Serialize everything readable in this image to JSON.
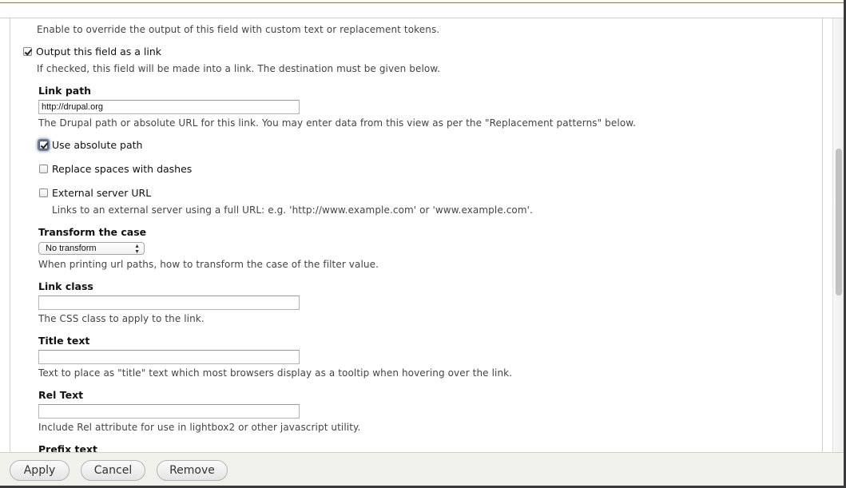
{
  "form": {
    "rewrite_description": "Enable to override the output of this field with custom text or replacement tokens.",
    "output_as_link": {
      "label": "Output this field as a link",
      "checked": true,
      "description": "If checked, this field will be made into a link. The destination must be given below."
    },
    "link_path": {
      "label": "Link path",
      "value": "http://drupal.org",
      "description": "The Drupal path or absolute URL for this link. You may enter data from this view as per the \"Replacement patterns\" below."
    },
    "use_absolute_path": {
      "label": "Use absolute path",
      "checked": true
    },
    "replace_spaces": {
      "label": "Replace spaces with dashes",
      "checked": false
    },
    "external_server": {
      "label": "External server URL",
      "checked": false,
      "description": "Links to an external server using a full URL: e.g. 'http://www.example.com' or 'www.example.com'."
    },
    "transform_case": {
      "label": "Transform the case",
      "selected": "No transform",
      "description": "When printing url paths, how to transform the case of the filter value."
    },
    "link_class": {
      "label": "Link class",
      "value": "",
      "description": "The CSS class to apply to the link."
    },
    "title_text": {
      "label": "Title text",
      "value": "",
      "description": "Text to place as \"title\" text which most browsers display as a tooltip when hovering over the link."
    },
    "rel_text": {
      "label": "Rel Text",
      "value": "",
      "description": "Include Rel attribute for use in lightbox2 or other javascript utility."
    },
    "prefix_text": {
      "label": "Prefix text"
    }
  },
  "footer": {
    "apply_label": "Apply",
    "cancel_label": "Cancel",
    "remove_label": "Remove"
  },
  "colors": {
    "accent_border": "#e0622f",
    "footer_bg": "#f1f1ec"
  }
}
